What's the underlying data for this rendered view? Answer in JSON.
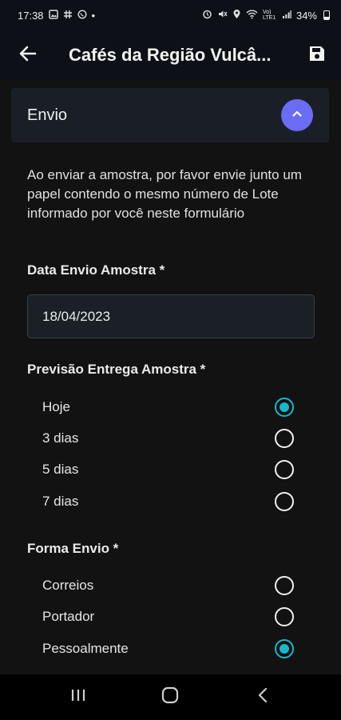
{
  "status_bar": {
    "time": "17:38",
    "dot": "•",
    "signal_label": "Vo) LTE1",
    "battery": "34%",
    "left_icons": [
      "gallery-icon",
      "hashtag-icon",
      "whatsapp-icon"
    ],
    "right_icons": [
      "alarm-icon",
      "mute-icon",
      "location-icon",
      "wifi-icon",
      "signal-icon",
      "battery-icon"
    ]
  },
  "app_bar": {
    "title": "Cafés da Região Vulcâ...",
    "back_icon": "arrow-left-icon",
    "save_icon": "save-icon"
  },
  "section": {
    "title": "Envio",
    "collapse_icon": "chevron-up-icon",
    "accent_color": "#6b6cf4"
  },
  "instructions": "Ao enviar a amostra, por favor envie junto um papel contendo o mesmo número de Lote informado por você neste formulário",
  "date_field": {
    "label": "Data Envio Amostra *",
    "value": "18/04/2023"
  },
  "forecast_field": {
    "label": "Previsão Entrega Amostra *",
    "options": [
      {
        "label": "Hoje",
        "checked": true
      },
      {
        "label": "3 dias",
        "checked": false
      },
      {
        "label": "5 dias",
        "checked": false
      },
      {
        "label": "7 dias",
        "checked": false
      }
    ]
  },
  "shipping_field": {
    "label": "Forma Envio *",
    "options": [
      {
        "label": "Correios",
        "checked": false
      },
      {
        "label": "Portador",
        "checked": false
      },
      {
        "label": "Pessoalmente",
        "checked": true
      }
    ]
  },
  "radio_color": "#18b8c9",
  "nav_bar": {
    "icons": [
      "recents-icon",
      "home-icon",
      "back-icon"
    ]
  }
}
